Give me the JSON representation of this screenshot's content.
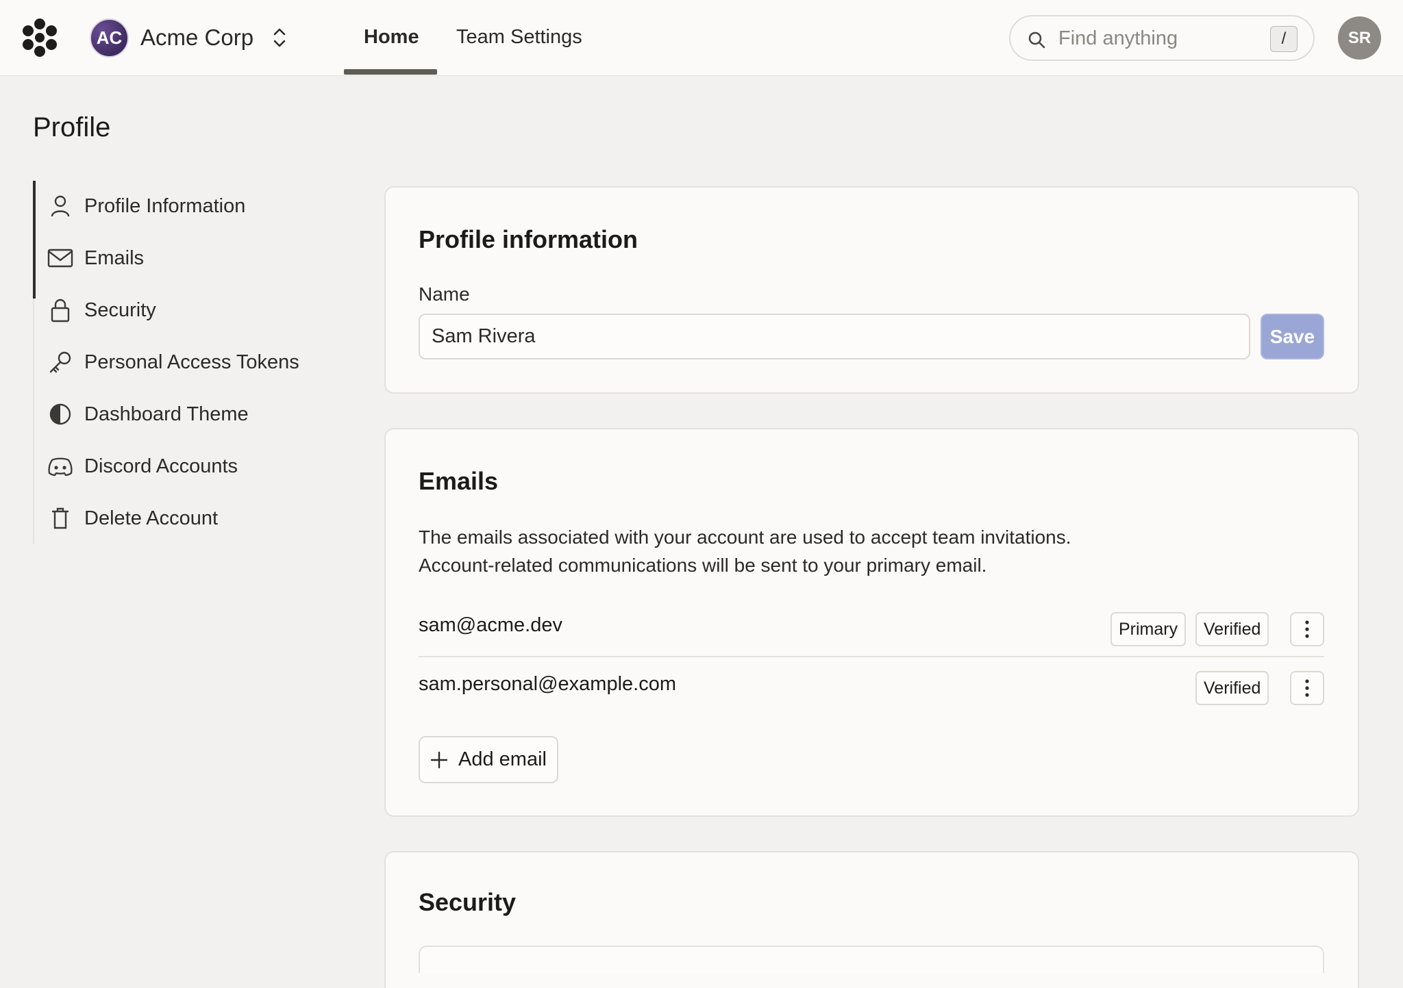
{
  "header": {
    "org": {
      "initials": "AC",
      "name": "Acme Corp"
    },
    "tabs": [
      {
        "label": "Home",
        "active": true
      },
      {
        "label": "Team Settings",
        "active": false
      }
    ],
    "search": {
      "placeholder": "Find anything",
      "shortcut": "/"
    },
    "user_initials": "SR"
  },
  "page": {
    "title": "Profile"
  },
  "sidebar": {
    "items": [
      {
        "label": "Profile Information",
        "icon": "user-icon",
        "active": true
      },
      {
        "label": "Emails",
        "icon": "mail-icon",
        "active": true
      },
      {
        "label": "Security",
        "icon": "lock-icon"
      },
      {
        "label": "Personal Access Tokens",
        "icon": "key-icon"
      },
      {
        "label": "Dashboard Theme",
        "icon": "contrast-icon"
      },
      {
        "label": "Discord Accounts",
        "icon": "discord-icon"
      },
      {
        "label": "Delete Account",
        "icon": "trash-icon"
      }
    ]
  },
  "profile": {
    "title": "Profile information",
    "name_label": "Name",
    "name_value": "Sam Rivera",
    "save_label": "Save"
  },
  "emails": {
    "title": "Emails",
    "description_line1": "The emails associated with your account are used to accept team invitations.",
    "description_line2": "Account-related communications will be sent to your primary email.",
    "list": [
      {
        "address": "sam@acme.dev",
        "badges": [
          "Primary",
          "Verified"
        ]
      },
      {
        "address": "sam.personal@example.com",
        "badges": [
          "Verified"
        ]
      }
    ],
    "add_label": "Add email"
  },
  "security": {
    "title": "Security"
  },
  "colors": {
    "background": "#f3f1ef",
    "card": "#fbfaf9",
    "save_button": "#9aa6d6",
    "org_avatar": "#4a3470",
    "user_avatar": "#8d8a86"
  }
}
